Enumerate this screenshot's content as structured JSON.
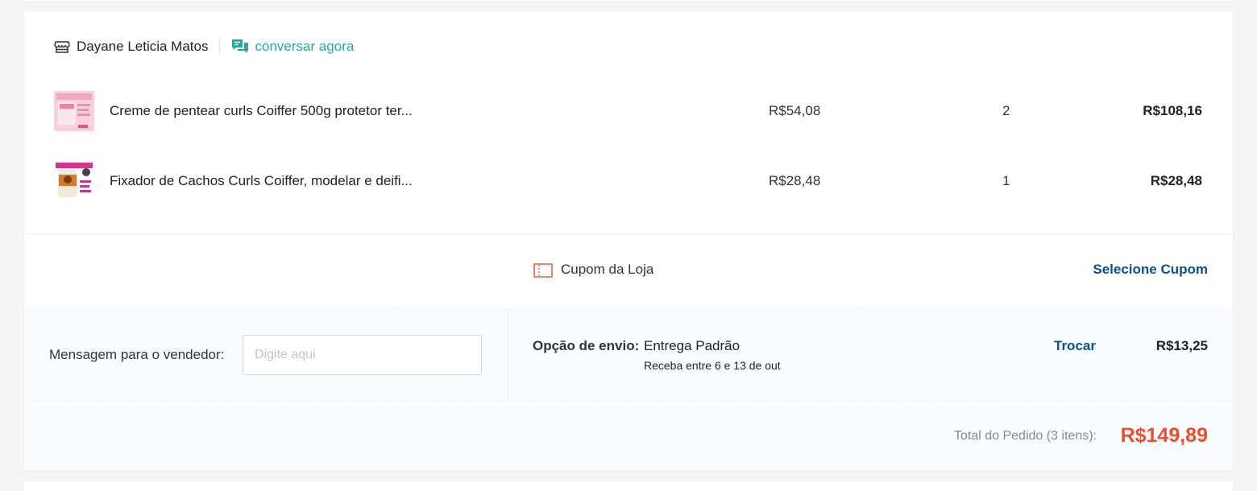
{
  "shop": {
    "name": "Dayane Leticia Matos",
    "chat_label": "conversar agora"
  },
  "items": [
    {
      "name": "Creme de pentear curls Coiffer 500g protetor ter...",
      "unit_price": "R$54,08",
      "quantity": "2",
      "subtotal": "R$108,16"
    },
    {
      "name": "Fixador de Cachos Curls Coiffer, modelar e deifi...",
      "unit_price": "R$28,48",
      "quantity": "1",
      "subtotal": "R$28,48"
    }
  ],
  "coupon": {
    "label": "Cupom da Loja",
    "action": "Selecione Cupom"
  },
  "message": {
    "label": "Mensagem para o vendedor:",
    "placeholder": "Digite aqui"
  },
  "shipping": {
    "label": "Opção de envio:",
    "option": "Entrega Padrão",
    "eta": "Receba entre 6 e 13 de out",
    "change_label": "Trocar",
    "price": "R$13,25"
  },
  "total": {
    "label": "Total do Pedido (3 itens):",
    "value": "R$149,89"
  },
  "colors": {
    "accent_green": "#26aa99",
    "link_blue": "#0a4f8f",
    "total_orange": "#ee4d2d"
  }
}
